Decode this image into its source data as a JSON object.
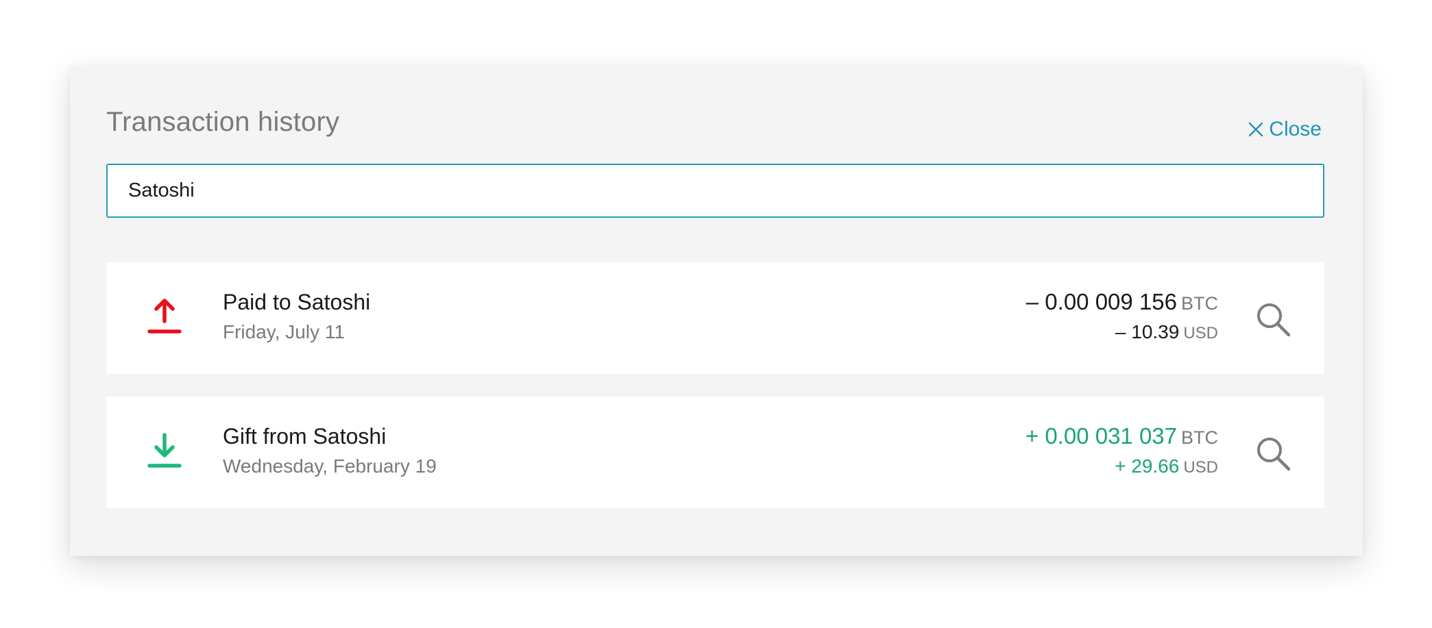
{
  "dialog": {
    "title": "Transaction history",
    "close_label": "Close"
  },
  "search": {
    "value": "Satoshi"
  },
  "transactions": [
    {
      "direction": "outgoing",
      "icon": "upload-arrow-icon",
      "title": "Paid to Satoshi",
      "date": "Friday, July 11",
      "btc_amount": "– 0.00 009 156",
      "btc_unit": "BTC",
      "usd_amount": "– 10.39",
      "usd_unit": "USD",
      "color": "#e8101a"
    },
    {
      "direction": "incoming",
      "icon": "download-arrow-icon",
      "title": "Gift from Satoshi",
      "date": "Wednesday, February 19",
      "btc_amount": "+ 0.00 031 037",
      "btc_unit": "BTC",
      "usd_amount": "+ 29.66",
      "usd_unit": "USD",
      "color": "#1eb87c"
    }
  ],
  "colors": {
    "accent": "#1f96b5",
    "outgoing": "#e8101a",
    "incoming": "#1eb87c",
    "positive_amount": "#1aa37a",
    "muted_text": "#7a7a7a",
    "panel_background": "#f4f4f4"
  }
}
